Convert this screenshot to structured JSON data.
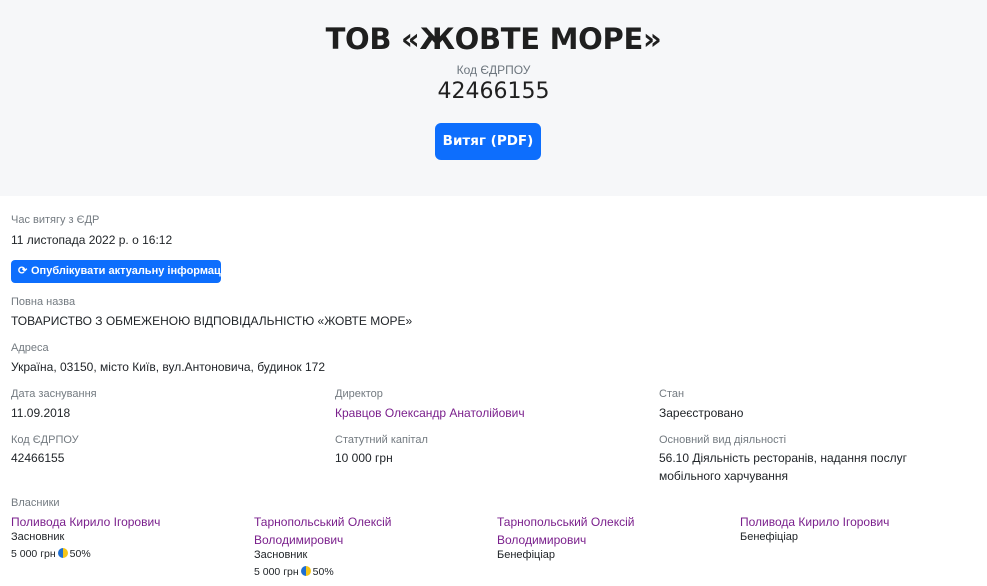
{
  "header": {
    "company_title": "ТОВ «ЖОВТЕ МОРЕ»",
    "code_label": "Код ЄДРПОУ",
    "code_value": "42466155",
    "pdf_button": "Витяг (PDF)"
  },
  "extract": {
    "time_label": "Час витягу з ЄДР",
    "time_value": "11 листопада 2022 р. о 16:12",
    "publish_button": "Опублікувати актуальну інформацію"
  },
  "full_name": {
    "label": "Повна назва",
    "value": "ТОВАРИСТВО З ОБМЕЖЕНОЮ ВІДПОВІДАЛЬНІСТЮ «ЖОВТЕ МОРЕ»"
  },
  "address": {
    "label": "Адреса",
    "value": "Україна, 03150, місто Київ, вул.Антоновича, будинок 172"
  },
  "details": {
    "founded_label": "Дата заснування",
    "founded_value": "11.09.2018",
    "director_label": "Директор",
    "director_value": "Кравцов Олександр Анатолійович",
    "status_label": "Стан",
    "status_value": "Зареєстровано",
    "code_label": "Код ЄДРПОУ",
    "code_value": "42466155",
    "capital_label": "Статутний капітал",
    "capital_value": "10 000 грн",
    "activity_label": "Основний вид діяльності",
    "activity_line1": "56.10 Діяльність ресторанів, надання послуг",
    "activity_line2": "мобільного харчування"
  },
  "owners": {
    "label": "Власники",
    "items": [
      {
        "name": "Поливода Кирило Ігорович",
        "role": "Засновник",
        "share": "5 000 грн",
        "percent": "50%"
      },
      {
        "name_line1": "Тарнопольський Олексій",
        "name_line2": "Володимирович",
        "role": "Засновник",
        "share": "5 000 грн",
        "percent": "50%"
      },
      {
        "name_line1": "Тарнопольський Олексій",
        "name_line2": "Володимирович",
        "role": "Бенефіціар"
      },
      {
        "name": "Поливода Кирило Ігорович",
        "role": "Бенефіціар"
      }
    ]
  },
  "colors": {
    "primary": "#0d6efd",
    "link": "#7a1f8c",
    "hero_bg": "#f6f7f9",
    "flag_blue": "#1f6fd1",
    "flag_yellow": "#f5c518"
  }
}
